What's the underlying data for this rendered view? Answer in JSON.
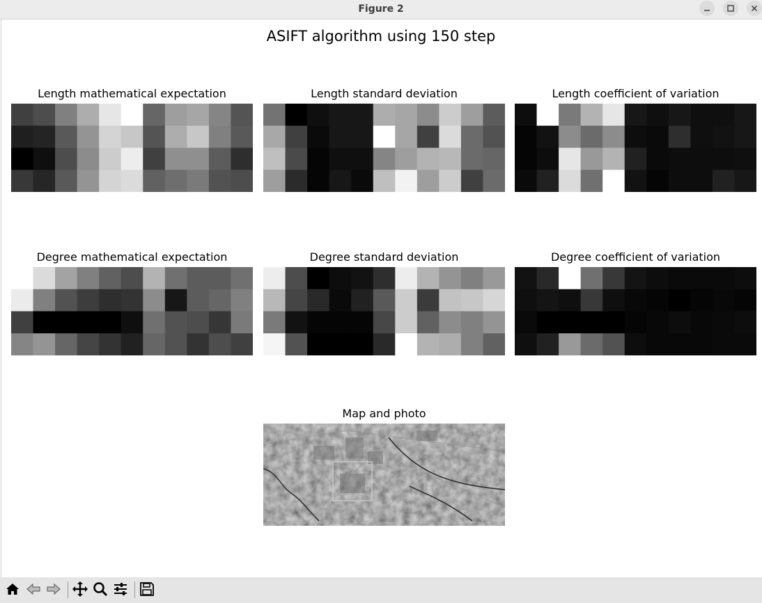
{
  "window": {
    "title": "Figure 2",
    "minimize_icon": "minimize-icon",
    "maximize_icon": "maximize-icon",
    "close_icon": "close-icon"
  },
  "figure": {
    "suptitle": "ASIFT algorithm using 150 step"
  },
  "chart_data": [
    {
      "type": "heatmap",
      "colormap": "gray",
      "title": "Length mathematical expectation",
      "values": [
        [
          0.25,
          0.3,
          0.5,
          0.68,
          0.9,
          1.0,
          0.4,
          0.62,
          0.65,
          0.52,
          0.33
        ],
        [
          0.12,
          0.14,
          0.35,
          0.58,
          0.83,
          0.78,
          0.33,
          0.68,
          0.78,
          0.5,
          0.35
        ],
        [
          0.0,
          0.06,
          0.3,
          0.55,
          0.8,
          0.93,
          0.25,
          0.56,
          0.56,
          0.36,
          0.18
        ],
        [
          0.22,
          0.15,
          0.35,
          0.58,
          0.83,
          0.86,
          0.38,
          0.43,
          0.48,
          0.32,
          0.3
        ]
      ]
    },
    {
      "type": "heatmap",
      "colormap": "gray",
      "title": "Length standard deviation",
      "values": [
        [
          0.45,
          0.0,
          0.06,
          0.09,
          0.09,
          0.68,
          0.65,
          0.55,
          0.8,
          0.62,
          0.36
        ],
        [
          0.66,
          0.25,
          0.04,
          0.09,
          0.09,
          1.0,
          0.65,
          0.25,
          0.86,
          0.42,
          0.32
        ],
        [
          0.75,
          0.29,
          0.02,
          0.06,
          0.06,
          0.52,
          0.62,
          0.7,
          0.72,
          0.42,
          0.4
        ],
        [
          0.62,
          0.17,
          0.02,
          0.09,
          0.04,
          0.75,
          0.95,
          0.62,
          0.8,
          0.25,
          0.42
        ]
      ]
    },
    {
      "type": "heatmap",
      "colormap": "gray",
      "title": "Length coefficient of variation",
      "values": [
        [
          0.05,
          1.0,
          0.48,
          0.7,
          0.9,
          0.09,
          0.06,
          0.09,
          0.06,
          0.06,
          0.09
        ],
        [
          0.02,
          0.07,
          0.55,
          0.42,
          0.55,
          0.05,
          0.04,
          0.18,
          0.06,
          0.07,
          0.09
        ],
        [
          0.02,
          0.05,
          0.9,
          0.6,
          0.7,
          0.13,
          0.04,
          0.05,
          0.05,
          0.05,
          0.06
        ],
        [
          0.04,
          0.13,
          0.86,
          0.44,
          1.0,
          0.07,
          0.02,
          0.05,
          0.05,
          0.13,
          0.09
        ]
      ]
    },
    {
      "type": "heatmap",
      "colormap": "gray",
      "title": "Degree mathematical expectation",
      "values": [
        [
          1.0,
          0.86,
          0.64,
          0.5,
          0.38,
          0.3,
          0.7,
          0.44,
          0.36,
          0.36,
          0.44
        ],
        [
          0.92,
          0.5,
          0.32,
          0.24,
          0.18,
          0.2,
          0.55,
          0.09,
          0.36,
          0.4,
          0.5
        ],
        [
          0.25,
          0.0,
          0.0,
          0.0,
          0.0,
          0.06,
          0.44,
          0.32,
          0.3,
          0.21,
          0.48
        ],
        [
          0.52,
          0.58,
          0.4,
          0.27,
          0.2,
          0.13,
          0.4,
          0.32,
          0.2,
          0.3,
          0.25
        ]
      ]
    },
    {
      "type": "heatmap",
      "colormap": "gray",
      "title": "Degree standard deviation",
      "values": [
        [
          0.93,
          0.3,
          0.0,
          0.05,
          0.07,
          0.18,
          0.93,
          0.7,
          0.58,
          0.5,
          0.6
        ],
        [
          0.72,
          0.27,
          0.16,
          0.04,
          0.13,
          0.35,
          0.8,
          0.23,
          0.76,
          0.78,
          0.84
        ],
        [
          0.48,
          0.07,
          0.02,
          0.02,
          0.02,
          0.28,
          0.8,
          0.38,
          0.55,
          0.5,
          0.58
        ],
        [
          0.96,
          0.32,
          0.0,
          0.0,
          0.0,
          0.16,
          1.0,
          0.7,
          0.68,
          0.5,
          0.38
        ]
      ]
    },
    {
      "type": "heatmap",
      "colormap": "gray",
      "title": "Degree coefficient of variation",
      "values": [
        [
          0.07,
          0.16,
          1.0,
          0.44,
          0.22,
          0.08,
          0.05,
          0.04,
          0.04,
          0.04,
          0.05
        ],
        [
          0.06,
          0.08,
          0.06,
          0.22,
          0.06,
          0.03,
          0.02,
          0.0,
          0.02,
          0.03,
          0.02
        ],
        [
          0.04,
          0.0,
          0.0,
          0.0,
          0.0,
          0.02,
          0.03,
          0.05,
          0.03,
          0.04,
          0.05
        ],
        [
          0.06,
          0.13,
          0.6,
          0.42,
          0.32,
          0.05,
          0.03,
          0.03,
          0.03,
          0.04,
          0.04
        ]
      ]
    }
  ],
  "map_panel": {
    "title": "Map and photo"
  },
  "toolbar": {
    "home": "home-icon",
    "back": "back-arrow-icon",
    "forward": "forward-arrow-icon",
    "pan": "pan-move-icon",
    "zoom": "zoom-magnifier-icon",
    "configure": "configure-subplots-icon",
    "save": "save-disk-icon"
  }
}
